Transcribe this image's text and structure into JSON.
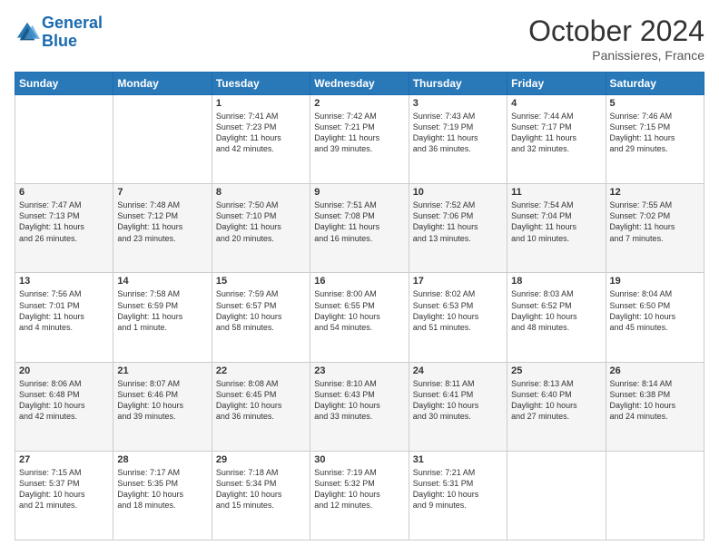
{
  "header": {
    "logo_line1": "General",
    "logo_line2": "Blue",
    "month": "October 2024",
    "location": "Panissieres, France"
  },
  "days_of_week": [
    "Sunday",
    "Monday",
    "Tuesday",
    "Wednesday",
    "Thursday",
    "Friday",
    "Saturday"
  ],
  "weeks": [
    [
      {
        "day": "",
        "content": ""
      },
      {
        "day": "",
        "content": ""
      },
      {
        "day": "1",
        "content": "Sunrise: 7:41 AM\nSunset: 7:23 PM\nDaylight: 11 hours\nand 42 minutes."
      },
      {
        "day": "2",
        "content": "Sunrise: 7:42 AM\nSunset: 7:21 PM\nDaylight: 11 hours\nand 39 minutes."
      },
      {
        "day": "3",
        "content": "Sunrise: 7:43 AM\nSunset: 7:19 PM\nDaylight: 11 hours\nand 36 minutes."
      },
      {
        "day": "4",
        "content": "Sunrise: 7:44 AM\nSunset: 7:17 PM\nDaylight: 11 hours\nand 32 minutes."
      },
      {
        "day": "5",
        "content": "Sunrise: 7:46 AM\nSunset: 7:15 PM\nDaylight: 11 hours\nand 29 minutes."
      }
    ],
    [
      {
        "day": "6",
        "content": "Sunrise: 7:47 AM\nSunset: 7:13 PM\nDaylight: 11 hours\nand 26 minutes."
      },
      {
        "day": "7",
        "content": "Sunrise: 7:48 AM\nSunset: 7:12 PM\nDaylight: 11 hours\nand 23 minutes."
      },
      {
        "day": "8",
        "content": "Sunrise: 7:50 AM\nSunset: 7:10 PM\nDaylight: 11 hours\nand 20 minutes."
      },
      {
        "day": "9",
        "content": "Sunrise: 7:51 AM\nSunset: 7:08 PM\nDaylight: 11 hours\nand 16 minutes."
      },
      {
        "day": "10",
        "content": "Sunrise: 7:52 AM\nSunset: 7:06 PM\nDaylight: 11 hours\nand 13 minutes."
      },
      {
        "day": "11",
        "content": "Sunrise: 7:54 AM\nSunset: 7:04 PM\nDaylight: 11 hours\nand 10 minutes."
      },
      {
        "day": "12",
        "content": "Sunrise: 7:55 AM\nSunset: 7:02 PM\nDaylight: 11 hours\nand 7 minutes."
      }
    ],
    [
      {
        "day": "13",
        "content": "Sunrise: 7:56 AM\nSunset: 7:01 PM\nDaylight: 11 hours\nand 4 minutes."
      },
      {
        "day": "14",
        "content": "Sunrise: 7:58 AM\nSunset: 6:59 PM\nDaylight: 11 hours\nand 1 minute."
      },
      {
        "day": "15",
        "content": "Sunrise: 7:59 AM\nSunset: 6:57 PM\nDaylight: 10 hours\nand 58 minutes."
      },
      {
        "day": "16",
        "content": "Sunrise: 8:00 AM\nSunset: 6:55 PM\nDaylight: 10 hours\nand 54 minutes."
      },
      {
        "day": "17",
        "content": "Sunrise: 8:02 AM\nSunset: 6:53 PM\nDaylight: 10 hours\nand 51 minutes."
      },
      {
        "day": "18",
        "content": "Sunrise: 8:03 AM\nSunset: 6:52 PM\nDaylight: 10 hours\nand 48 minutes."
      },
      {
        "day": "19",
        "content": "Sunrise: 8:04 AM\nSunset: 6:50 PM\nDaylight: 10 hours\nand 45 minutes."
      }
    ],
    [
      {
        "day": "20",
        "content": "Sunrise: 8:06 AM\nSunset: 6:48 PM\nDaylight: 10 hours\nand 42 minutes."
      },
      {
        "day": "21",
        "content": "Sunrise: 8:07 AM\nSunset: 6:46 PM\nDaylight: 10 hours\nand 39 minutes."
      },
      {
        "day": "22",
        "content": "Sunrise: 8:08 AM\nSunset: 6:45 PM\nDaylight: 10 hours\nand 36 minutes."
      },
      {
        "day": "23",
        "content": "Sunrise: 8:10 AM\nSunset: 6:43 PM\nDaylight: 10 hours\nand 33 minutes."
      },
      {
        "day": "24",
        "content": "Sunrise: 8:11 AM\nSunset: 6:41 PM\nDaylight: 10 hours\nand 30 minutes."
      },
      {
        "day": "25",
        "content": "Sunrise: 8:13 AM\nSunset: 6:40 PM\nDaylight: 10 hours\nand 27 minutes."
      },
      {
        "day": "26",
        "content": "Sunrise: 8:14 AM\nSunset: 6:38 PM\nDaylight: 10 hours\nand 24 minutes."
      }
    ],
    [
      {
        "day": "27",
        "content": "Sunrise: 7:15 AM\nSunset: 5:37 PM\nDaylight: 10 hours\nand 21 minutes."
      },
      {
        "day": "28",
        "content": "Sunrise: 7:17 AM\nSunset: 5:35 PM\nDaylight: 10 hours\nand 18 minutes."
      },
      {
        "day": "29",
        "content": "Sunrise: 7:18 AM\nSunset: 5:34 PM\nDaylight: 10 hours\nand 15 minutes."
      },
      {
        "day": "30",
        "content": "Sunrise: 7:19 AM\nSunset: 5:32 PM\nDaylight: 10 hours\nand 12 minutes."
      },
      {
        "day": "31",
        "content": "Sunrise: 7:21 AM\nSunset: 5:31 PM\nDaylight: 10 hours\nand 9 minutes."
      },
      {
        "day": "",
        "content": ""
      },
      {
        "day": "",
        "content": ""
      }
    ]
  ]
}
